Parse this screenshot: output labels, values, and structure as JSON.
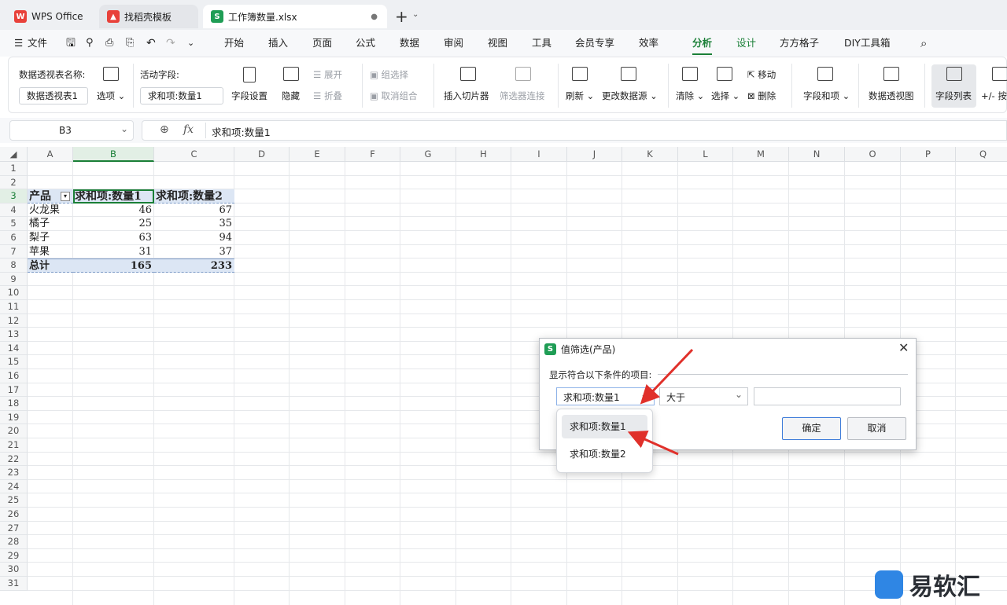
{
  "tabs": [
    {
      "label": "WPS Office",
      "icon": "wps-logo-icon"
    },
    {
      "label": "找稻壳模板",
      "icon": "docer-icon"
    },
    {
      "label": "工作簿数量.xlsx",
      "icon": "sheet-icon",
      "icon_letter": "S"
    }
  ],
  "menu": {
    "file": "文件",
    "items": [
      "开始",
      "插入",
      "页面",
      "公式",
      "数据",
      "审阅",
      "视图",
      "工具",
      "会员专享",
      "效率",
      "分析",
      "设计",
      "方方格子",
      "DIY工具箱"
    ],
    "active": "分析"
  },
  "ribbon": {
    "pivot_name_label": "数据透视表名称:",
    "pivot_name_value": "数据透视表1",
    "options": "选项",
    "active_field_label": "活动字段:",
    "active_field_value": "求和项:数量1",
    "field_settings": "字段设置",
    "hide": "隐藏",
    "expand": "展开",
    "collapse": "折叠",
    "group_select": "组选择",
    "ungroup": "取消组合",
    "insert_slicer": "插入切片器",
    "filter_connections": "筛选器连接",
    "refresh": "刷新",
    "change_source": "更改数据源",
    "clear": "清除",
    "select": "选择",
    "move": "移动",
    "delete": "删除",
    "fields_items": "字段和项",
    "pivot_view": "数据透视图",
    "field_list": "字段列表",
    "plus_minus": "+/- 按"
  },
  "formula_bar": {
    "name_box": "B3",
    "fx": "fx",
    "content": "求和项:数量1"
  },
  "columns": [
    "A",
    "B",
    "C",
    "D",
    "E",
    "F",
    "G",
    "H",
    "I",
    "J",
    "K",
    "L",
    "M",
    "N",
    "O",
    "P",
    "Q"
  ],
  "rows": [
    "1",
    "2",
    "3",
    "4",
    "5",
    "6",
    "7",
    "8",
    "9",
    "10",
    "11",
    "12",
    "13",
    "14",
    "15",
    "16",
    "17",
    "18",
    "19",
    "20",
    "21",
    "22",
    "23",
    "24",
    "25",
    "26",
    "27",
    "28",
    "29",
    "30",
    "31"
  ],
  "pivot": {
    "headers": [
      "产品",
      "求和项:数量1",
      "求和项:数量2"
    ],
    "data": [
      [
        "火龙果",
        "46",
        "67"
      ],
      [
        "橘子",
        "25",
        "35"
      ],
      [
        "梨子",
        "63",
        "94"
      ],
      [
        "苹果",
        "31",
        "37"
      ]
    ],
    "total": [
      "总计",
      "165",
      "233"
    ]
  },
  "dialog": {
    "title": "值筛选(产品)",
    "instruction": "显示符合以下条件的项目:",
    "field_value": "求和项:数量1",
    "operator_value": "大于",
    "input_value": "",
    "ok": "确定",
    "cancel": "取消",
    "dropdown_options": [
      "求和项:数量1",
      "求和项:数量2"
    ]
  },
  "watermark": "易软汇"
}
